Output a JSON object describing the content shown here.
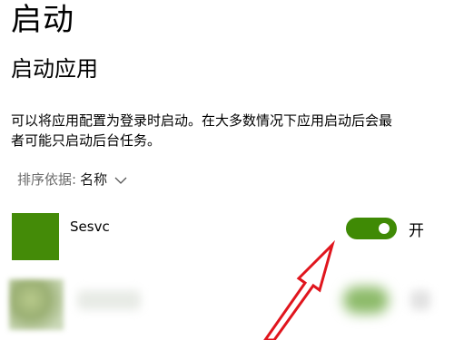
{
  "header": {
    "title": "启动"
  },
  "section": {
    "title": "启动应用"
  },
  "description": {
    "line1": "可以将应用配置为登录时启动。在大多数情况下应用启动后会最",
    "line2": "者可能只启动后台任务。"
  },
  "sort": {
    "label": "排序依据:",
    "value": "名称"
  },
  "apps": [
    {
      "name": "Sesvc",
      "state": "开",
      "enabled": true,
      "tile_color": "#448b08"
    }
  ],
  "colors": {
    "toggle_on": "#3f8a05",
    "arrow": "#e0151d"
  },
  "icons": {
    "sort_chevron": "chevron-down-icon",
    "annotation": "red-arrow-icon"
  }
}
